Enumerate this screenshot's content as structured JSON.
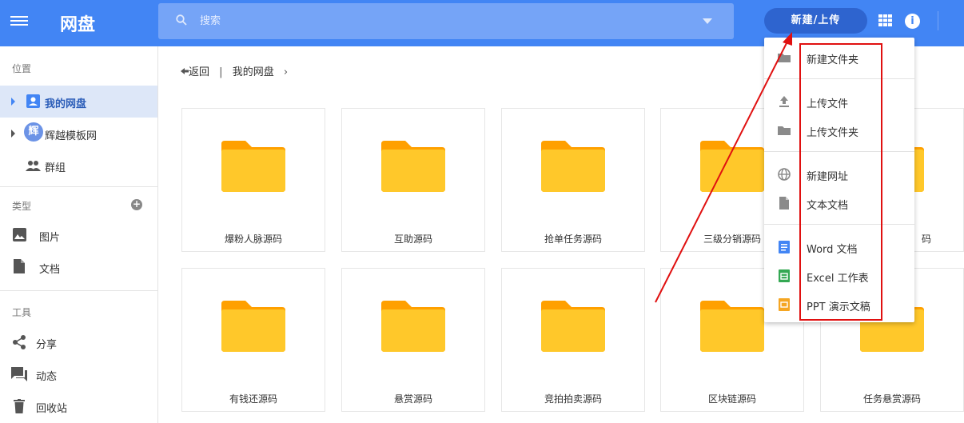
{
  "header": {
    "title": "网盘",
    "search_placeholder": "搜索",
    "new_button": "新建/上传",
    "info_glyph": "i"
  },
  "sidebar": {
    "section_location": "位置",
    "my_drive": "我的网盘",
    "shared_account": "辉越模板网",
    "shared_avatar": "辉",
    "groups": "群组",
    "section_type": "类型",
    "images": "图片",
    "documents": "文档",
    "section_tools": "工具",
    "share": "分享",
    "activity": "动态",
    "trash": "回收站"
  },
  "breadcrumb": {
    "back": "返回",
    "sep": "|",
    "current": "我的网盘",
    "arrow": "›"
  },
  "files": [
    "爆粉人脉源码",
    "互助源码",
    "抢单任务源码",
    "三级分销源码",
    "码",
    "有钱还源码",
    "悬赏源码",
    "竞拍拍卖源码",
    "区块链源码",
    "任务悬赏源码"
  ],
  "menu": {
    "new_folder": "新建文件夹",
    "upload_file": "上传文件",
    "upload_folder": "上传文件夹",
    "new_url": "新建网址",
    "text_doc": "文本文档",
    "word_doc": "Word 文档",
    "excel_sheet": "Excel 工作表",
    "ppt_doc": "PPT 演示文稿"
  },
  "colors": {
    "brand": "#4285f4",
    "folder": "#ffc82a",
    "annotation": "#e01010"
  }
}
